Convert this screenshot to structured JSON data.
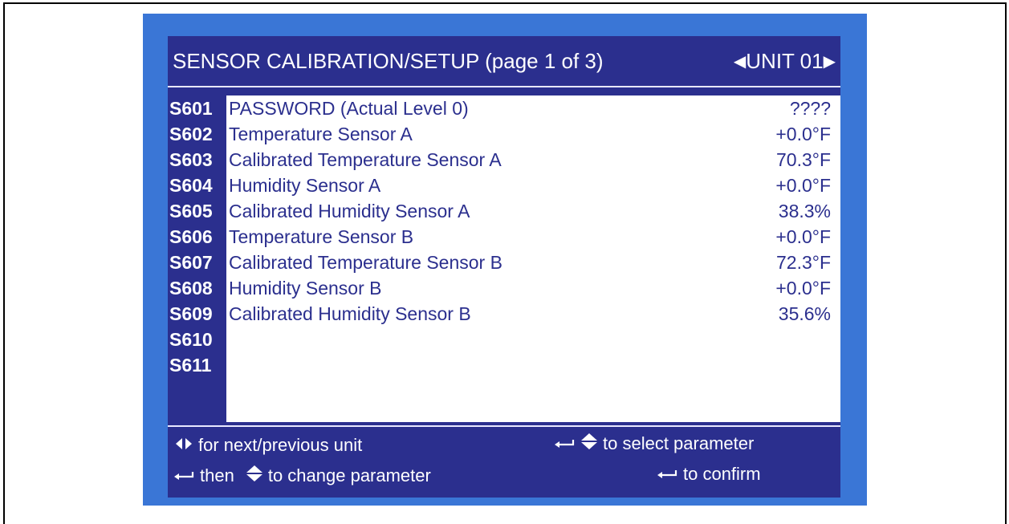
{
  "header": {
    "title": "SENSOR CALIBRATION/SETUP (page 1 of 3)",
    "unit_label": "UNIT 01",
    "prev_arrow_icon": "triangle-left-icon",
    "next_arrow_icon": "triangle-right-icon"
  },
  "rows": [
    {
      "code": "S601",
      "label": "PASSWORD   (Actual Level  0)",
      "value": "????"
    },
    {
      "code": "S602",
      "label": "Temperature Sensor A",
      "value": "+0.0°F"
    },
    {
      "code": "S603",
      "label": "Calibrated Temperature Sensor A",
      "value": "70.3°F"
    },
    {
      "code": "S604",
      "label": "Humidity Sensor A",
      "value": "+0.0°F"
    },
    {
      "code": "S605",
      "label": "Calibrated Humidity Sensor A",
      "value": "38.3%"
    },
    {
      "code": "S606",
      "label": "Temperature Sensor B",
      "value": "+0.0°F"
    },
    {
      "code": "S607",
      "label": "Calibrated Temperature Sensor B",
      "value": "72.3°F"
    },
    {
      "code": "S608",
      "label": "Humidity Sensor B",
      "value": "+0.0°F"
    },
    {
      "code": "S609",
      "label": "Calibrated Humidity Sensor B",
      "value": "35.6%"
    },
    {
      "code": "S610",
      "label": "",
      "value": ""
    },
    {
      "code": "S611",
      "label": "",
      "value": ""
    }
  ],
  "footer": {
    "next_prev_unit": "for next/previous unit",
    "select_parameter": "to select parameter",
    "then": "then",
    "change_parameter": "to change parameter",
    "confirm": "to confirm"
  },
  "colors": {
    "outer_blue": "#3a76d6",
    "panel_navy": "#2b2f8e",
    "content_white": "#ffffff"
  }
}
